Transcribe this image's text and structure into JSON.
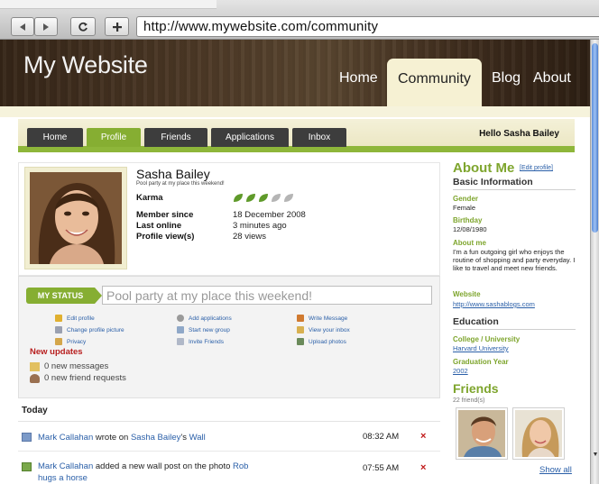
{
  "browser": {
    "url": "http://www.mywebsite.com/community",
    "buttons": {
      "back": "back",
      "forward": "forward",
      "reload": "reload",
      "new_tab": "+"
    }
  },
  "site": {
    "title": "My Website",
    "nav": [
      "Home",
      "Community",
      "Blog",
      "About"
    ],
    "active_nav": "Community"
  },
  "profile_tabs": {
    "items": [
      "Home",
      "Profile",
      "Friends",
      "Applications",
      "Inbox"
    ],
    "active": "Profile",
    "greeting": "Hello Sasha Bailey"
  },
  "profile": {
    "name": "Sasha Bailey",
    "status_line": "Pool party at my place this weekend!",
    "karma_label": "Karma",
    "karma_level": 3,
    "karma_max": 5,
    "member_since_label": "Member since",
    "member_since": "18 December 2008",
    "last_online_label": "Last online",
    "last_online": "3 minutes ago",
    "views_label": "Profile view(s)",
    "views": "28 views"
  },
  "status": {
    "label": "MY STATUS",
    "value": "Pool party at my place this weekend!"
  },
  "actions": {
    "col1": [
      "Edit profile",
      "Change profile picture",
      "Privacy"
    ],
    "col2": [
      "Add applications",
      "Start new group",
      "Invite Friends"
    ],
    "col3": [
      "Write Message",
      "View your inbox",
      "Upload photos"
    ]
  },
  "updates": {
    "title": "New updates",
    "messages": "0 new messages",
    "requests": "0 new friend requests"
  },
  "feed": {
    "heading": "Today",
    "items": [
      {
        "actor": "Mark Callahan",
        "text1": " wrote on ",
        "target": "Sasha Bailey",
        "text2": "'s ",
        "object": "Wall",
        "time": "08:32 AM",
        "delete": "×"
      },
      {
        "actor": "Mark Callahan",
        "text1": " added a new wall post on the photo ",
        "target": "Rob hugs a horse",
        "text2": "",
        "object": "",
        "time": "07:55 AM",
        "delete": "×"
      }
    ]
  },
  "about": {
    "title": "About Me",
    "edit_link": "[Edit profile]",
    "basic_heading": "Basic Information",
    "gender_label": "Gender",
    "gender": "Female",
    "birthday_label": "Birthday",
    "birthday": "12/08/1980",
    "aboutme_label": "About me",
    "aboutme": "I'm a fun outgoing girl who enjoys the routine of shopping and party everyday. I like to travel and meet new friends.",
    "website_label": "Website",
    "website": "http://www.sashablogs.com",
    "education_heading": "Education",
    "college_label": "College / University",
    "college": "Harvard University",
    "grad_label": "Graduation Year",
    "grad": "2002"
  },
  "friends": {
    "title": "Friends",
    "count": "22 friend(s)",
    "show_all": "Show all"
  },
  "colors": {
    "accent_green": "#86ae32",
    "link_blue": "#2a5fa8",
    "delete_red": "#c01818"
  }
}
